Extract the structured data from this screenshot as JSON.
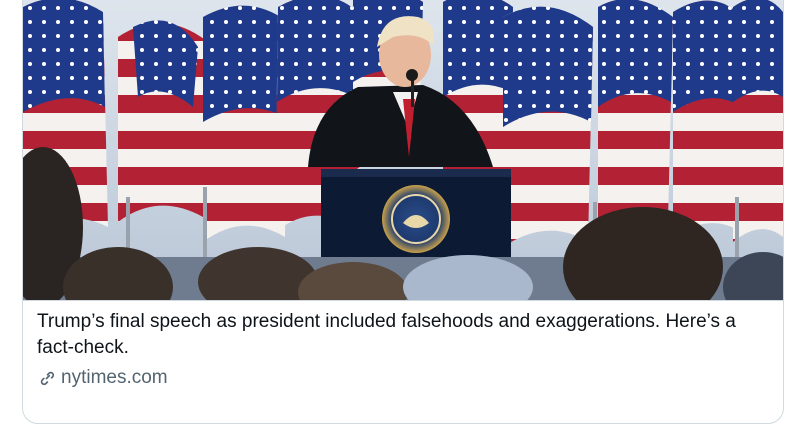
{
  "card": {
    "title": "Trump’s final speech as president included falsehoods and exaggerations. Here’s a fact-check.",
    "domain": "nytimes.com",
    "link_icon": "link-icon"
  },
  "image": {
    "subject": "photo-speaker-at-podium-with-flags"
  },
  "colors": {
    "border": "#cfd9de",
    "title_text": "#0f1419",
    "meta_text": "#536471"
  }
}
